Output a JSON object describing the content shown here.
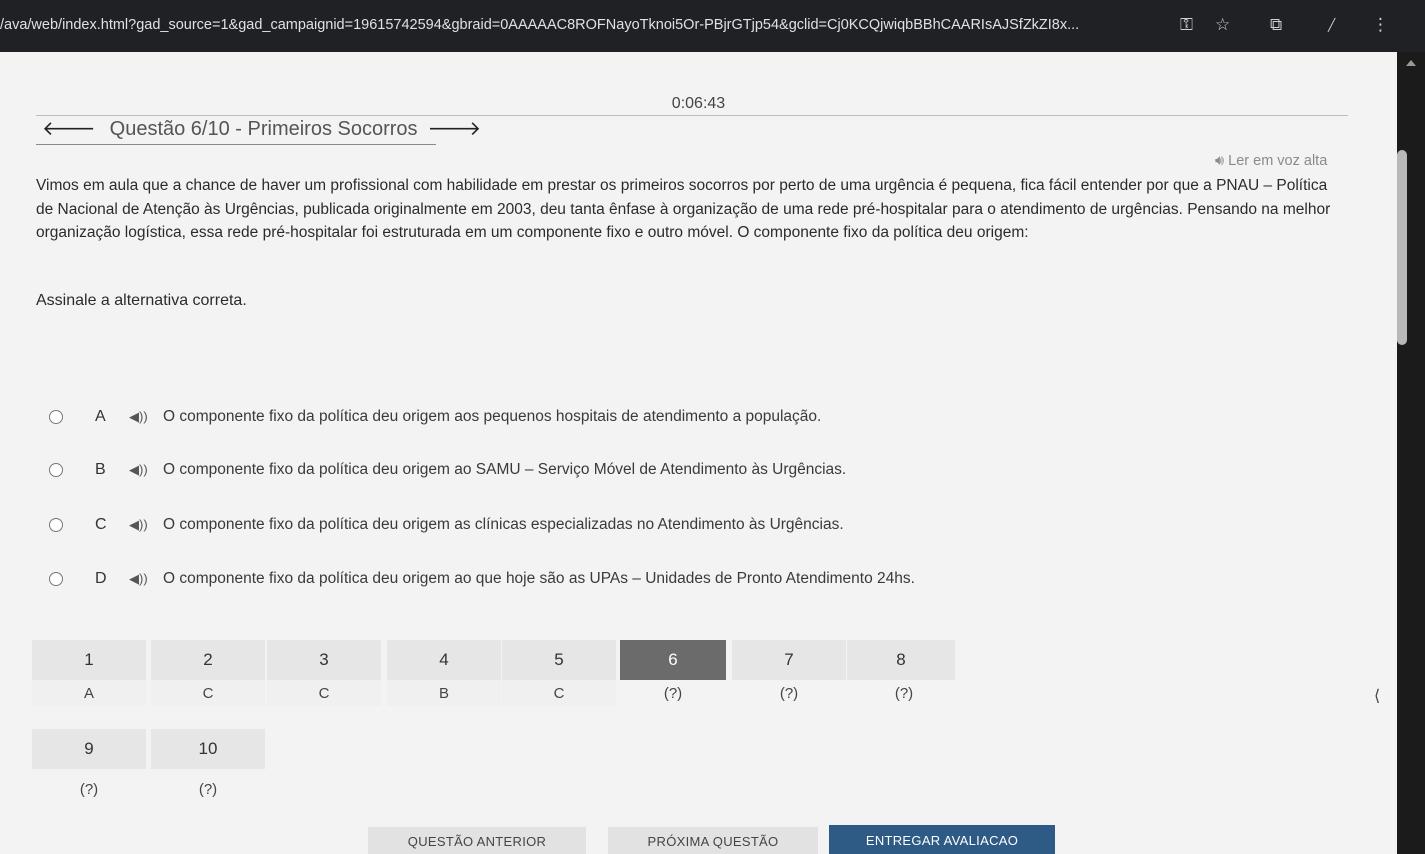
{
  "browser": {
    "url": "/ava/web/index.html?gad_source=1&gad_campaignid=19615742594&gbraid=0AAAAAC8ROFNayoTknoi5Or-PBjrGTjp54&gclid=Cj0KCQjwiqbBBhCAARIsAJSfZkZI8x..."
  },
  "timer": "0:06:43",
  "header": {
    "title": "Questão 6/10 - Primeiros Socorros"
  },
  "read_aloud": "Ler em voz alta",
  "question": {
    "text": "Vimos em aula que a chance de haver um profissional com habilidade em prestar os primeiros socorros por perto de uma urgência é pequena, fica fácil entender por que a PNAU – Política de Nacional de Atenção às Urgências, publicada originalmente em 2003, deu tanta ênfase à organização de uma rede pré-hospitalar para o atendimento de urgências. Pensando na melhor organização logística, essa rede pré-hospitalar foi estruturada em um componente fixo e outro móvel. O componente fixo da política deu origem:",
    "instruction": "Assinale a alternativa correta."
  },
  "options": [
    {
      "letter": "A",
      "text": "O componente fixo da política deu origem aos pequenos hospitais de atendimento a população."
    },
    {
      "letter": "B",
      "text": "O componente fixo da política deu origem ao SAMU – Serviço Móvel de Atendimento às Urgências."
    },
    {
      "letter": "C",
      "text": "O componente fixo da política deu origem as clínicas especializadas no Atendimento às Urgências."
    },
    {
      "letter": "D",
      "text": "O componente fixo da política deu origem ao que hoje são as UPAs – Unidades de Pronto Atendimento 24hs."
    }
  ],
  "navigator": [
    {
      "num": "1",
      "answer": "A"
    },
    {
      "num": "2",
      "answer": "C"
    },
    {
      "num": "3",
      "answer": "C"
    },
    {
      "num": "4",
      "answer": "B"
    },
    {
      "num": "5",
      "answer": "C"
    },
    {
      "num": "6",
      "answer": "(?)"
    },
    {
      "num": "7",
      "answer": "(?)"
    },
    {
      "num": "8",
      "answer": "(?)"
    },
    {
      "num": "9",
      "answer": "(?)"
    },
    {
      "num": "10",
      "answer": "(?)"
    }
  ],
  "buttons": {
    "prev": "QUESTÃO ANTERIOR",
    "next": "PRÓXIMA QUESTÃO",
    "submit": "ENTREGAR AVALIACAO"
  },
  "icons": {
    "back": "arrow-left-icon",
    "forward": "arrow-right-icon",
    "speaker": "speaker-icon",
    "key": "key-icon",
    "star": "star-icon",
    "extensions": "puzzle-icon",
    "menu": "kebab-menu-icon"
  },
  "colors": {
    "submit_bg": "#2e5a86",
    "current_question_bg": "#6b6b6b"
  }
}
